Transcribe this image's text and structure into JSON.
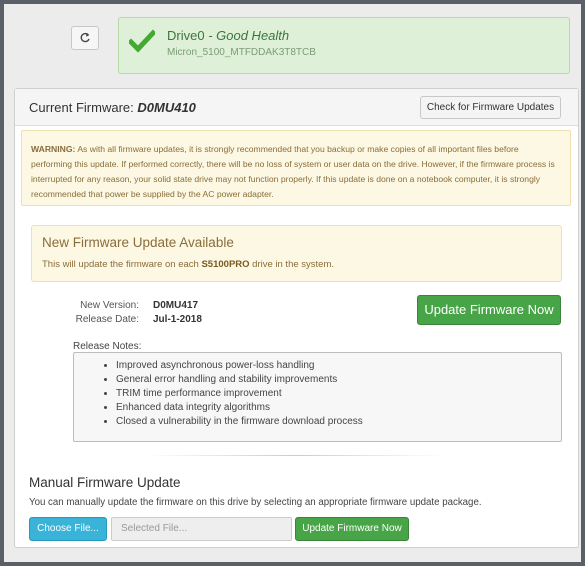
{
  "drive": {
    "name": "Drive0",
    "separator": " - ",
    "health": "Good Health",
    "model": "Micron_5100_MTFDDAK3T8TCB",
    "icons": {
      "refresh": "refresh-icon",
      "status": "checkmark-icon"
    },
    "status_color": "#45a832"
  },
  "firmware": {
    "current_label": "Current Firmware:",
    "current_value": "D0MU410",
    "check_updates_label": "Check for Firmware Updates"
  },
  "warning": {
    "prefix": "WARNING:",
    "text": " As with all firmware updates, it is strongly recommended that you backup or make copies of all important files before performing this update. If performed correctly, there will be no loss of system or user data on the drive. However, if the firmware process is interrupted for any reason, your solid state drive may not function properly. If this update is done on a notebook computer, it is strongly recommended that power be supplied by the AC power adapter."
  },
  "update_available": {
    "title": "New Firmware Update Available",
    "text_before": "This will update the firmware on each ",
    "drive_family": "S5100PRO",
    "text_after": " drive in the system."
  },
  "new_version": {
    "label": "New Version:",
    "value": "D0MU417"
  },
  "release_date": {
    "label": "Release Date:",
    "value": "Jul-1-2018"
  },
  "update_now_label": "Update Firmware Now",
  "release_notes": {
    "label": "Release Notes:",
    "items": [
      "Improved asynchronous power-loss handling",
      "General error handling and stability improvements",
      "TRIM time performance improvement",
      "Enhanced data integrity algorithms",
      "Closed a vulnerability in the firmware download process"
    ]
  },
  "manual": {
    "title": "Manual Firmware Update",
    "description": "You can manually update the firmware on this drive by selecting an appropriate firmware update package.",
    "choose_file_label": "Choose File...",
    "selected_file_placeholder": "Selected File...",
    "update_label": "Update Firmware Now"
  },
  "colors": {
    "success_green": "#47a447",
    "info_blue": "#39b3d7",
    "warning_bg": "#fcf8e3",
    "health_bg": "#dff0d8"
  }
}
